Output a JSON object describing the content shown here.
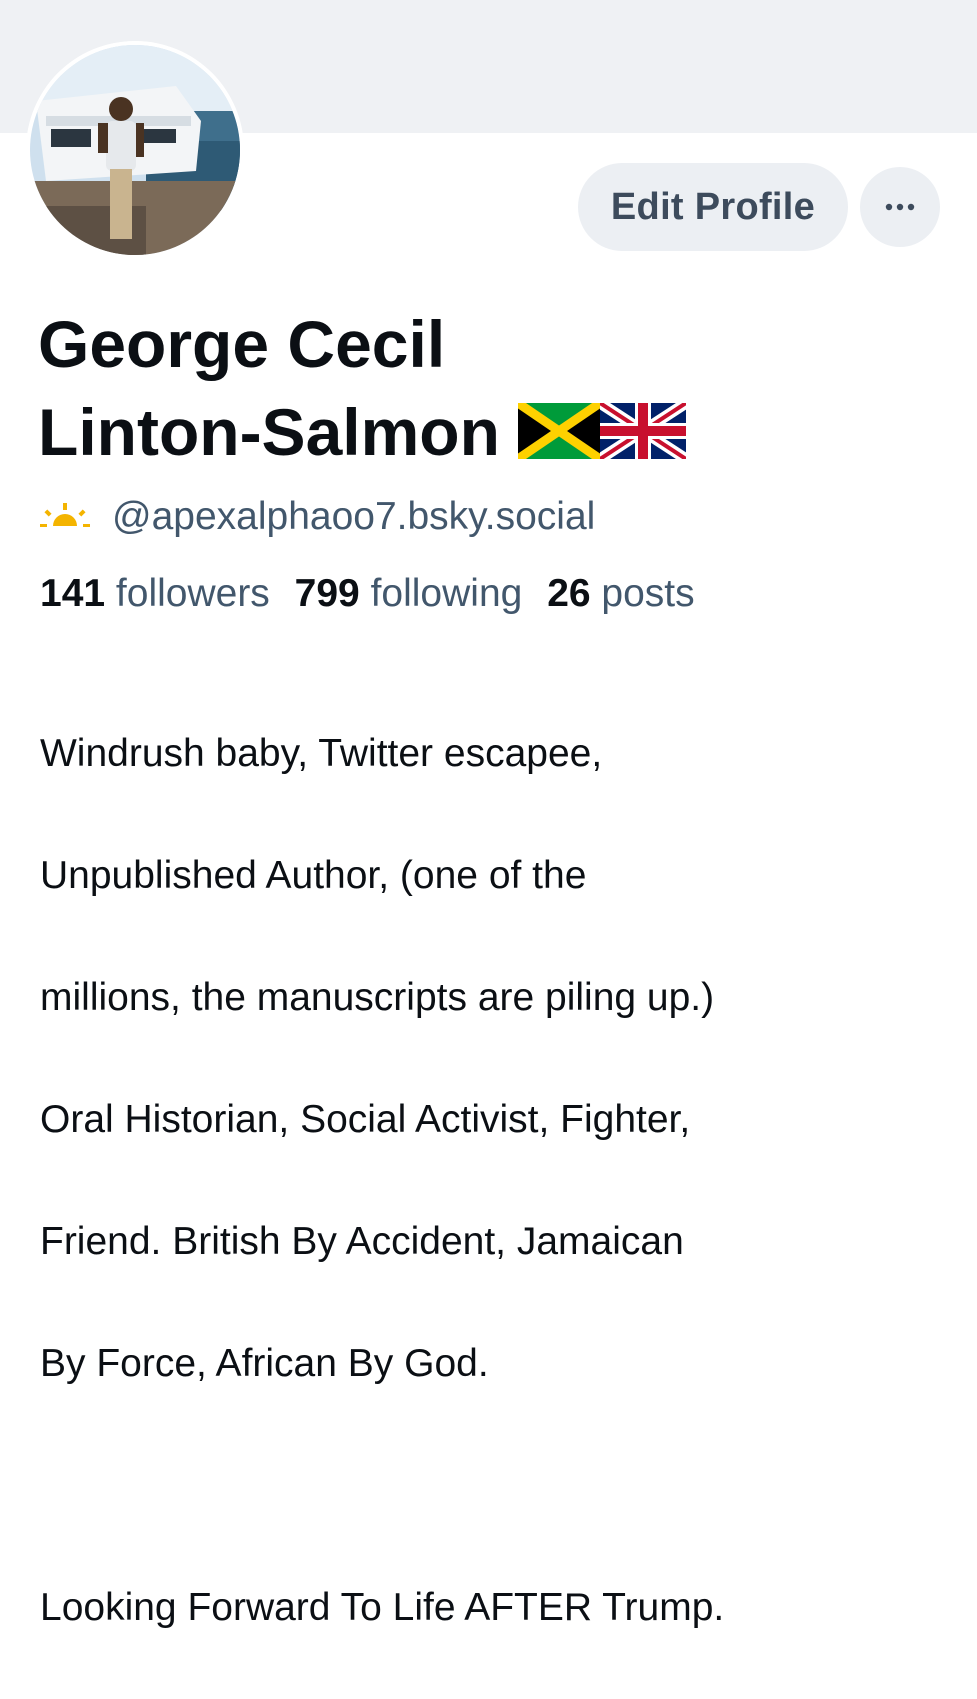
{
  "header": {
    "banner_color": "#eff1f4"
  },
  "profile": {
    "avatar_icon": "avatar-photo",
    "display_name_line1": "George Cecil",
    "display_name_line2": "Linton-Salmon",
    "name_flags": [
      "jamaica-flag-icon",
      "uk-flag-icon"
    ],
    "handle_icon": "sun-icon",
    "handle": "@apexalphaoo7.bsky.social"
  },
  "actions": {
    "edit_profile_label": "Edit Profile",
    "more_icon": "ellipsis-icon"
  },
  "stats": {
    "followers_count": "141",
    "followers_label": "followers",
    "following_count": "799",
    "following_label": "following",
    "posts_count": "26",
    "posts_label": "posts"
  },
  "bio": {
    "lines": [
      "Windrush baby, Twitter escapee,",
      "Unpublished Author, (one of the",
      "millions, the manuscripts are piling up.)",
      "Oral Historian, Social Activist, Fighter,",
      "Friend. British By Accident, Jamaican",
      "By Force, African By God."
    ],
    "closing_line": "Looking Forward To Life AFTER Trump."
  },
  "colors": {
    "text_primary": "#0b0f14",
    "text_secondary": "#42576c",
    "button_bg": "#eceff3",
    "button_text": "#3d4b5c"
  }
}
